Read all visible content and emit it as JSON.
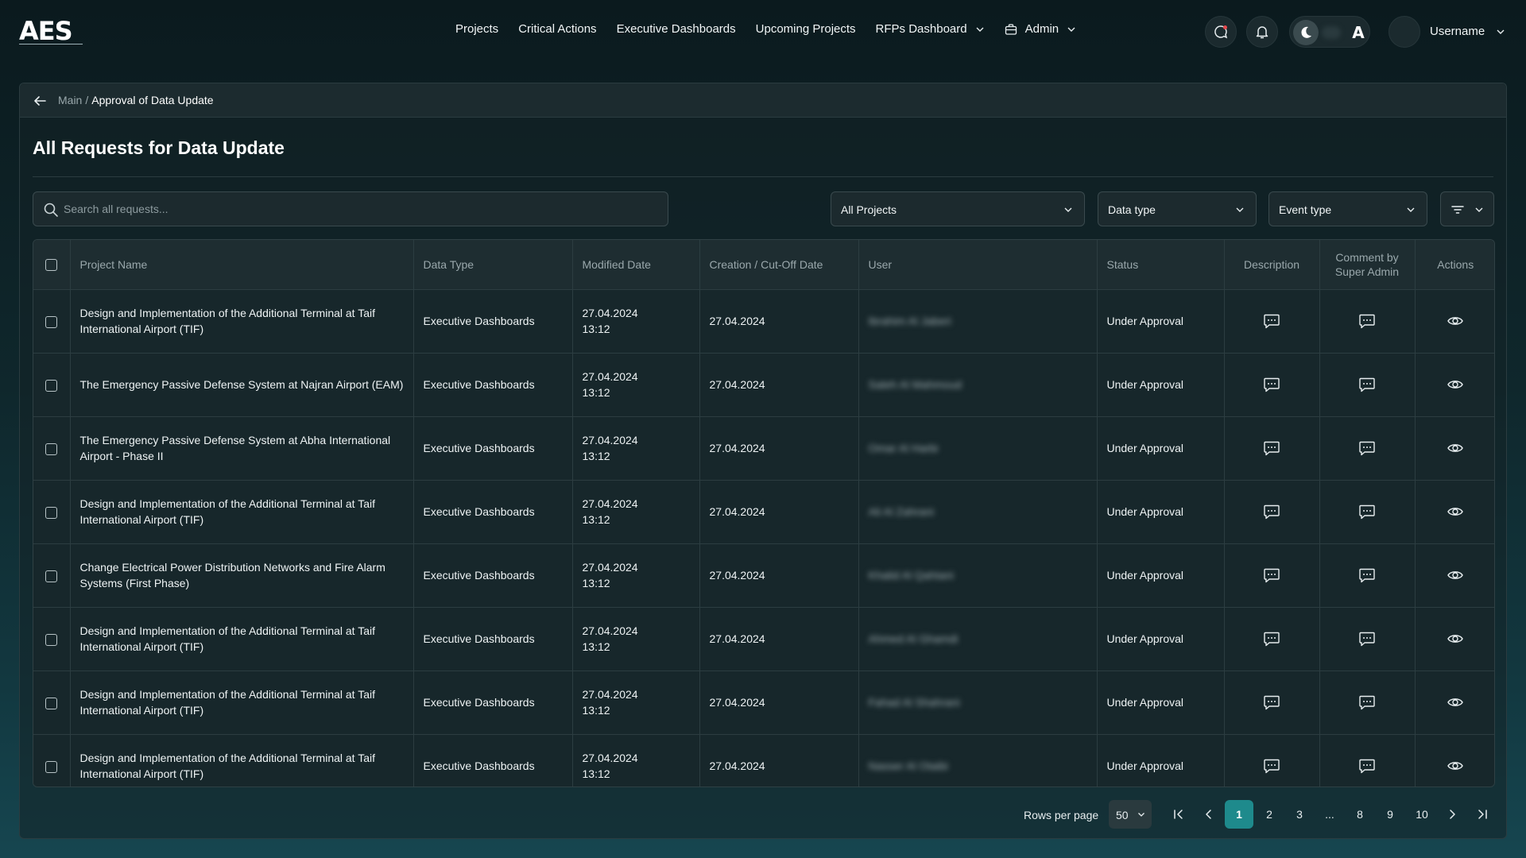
{
  "brand": {
    "logo": "AES"
  },
  "nav": {
    "items": [
      "Projects",
      "Critical Actions",
      "Executive Dashboards",
      "Upcoming Projects"
    ],
    "rfps": "RFPs Dashboard",
    "admin": "Admin"
  },
  "user": {
    "name": "Username"
  },
  "theme": {
    "letter": "A"
  },
  "breadcrumb": {
    "main": "Main",
    "sep": "/",
    "current": "Approval of Data Update"
  },
  "page": {
    "title": "All Requests for Data Update"
  },
  "filters": {
    "search_placeholder": "Search all requests...",
    "projects": "All Projects",
    "data_type": "Data type",
    "event_type": "Event type"
  },
  "table": {
    "headers": {
      "project": "Project Name",
      "data_type": "Data Type",
      "modified": "Modified Date",
      "creation": "Creation / Cut-Off Date",
      "user": "User",
      "status": "Status",
      "description": "Description",
      "comment_line1": "Comment by",
      "comment_line2": "Super Admin",
      "actions": "Actions"
    },
    "rows": [
      {
        "project": "Design and Implementation of the Additional Terminal at Taif International Airport (TIF)",
        "data_type": "Executive Dashboards",
        "mod_date": "27.04.2024",
        "mod_time": "13:12",
        "creation": "27.04.2024",
        "user": "Ibrahim Al Jaberi",
        "status": "Under Approval"
      },
      {
        "project": "The Emergency Passive Defense System at Najran Airport (EAM)",
        "data_type": "Executive Dashboards",
        "mod_date": "27.04.2024",
        "mod_time": "13:12",
        "creation": "27.04.2024",
        "user": "Saleh Al Mahmoud",
        "status": "Under Approval"
      },
      {
        "project": "The Emergency Passive Defense System at Abha International Airport - Phase II",
        "data_type": "Executive Dashboards",
        "mod_date": "27.04.2024",
        "mod_time": "13:12",
        "creation": "27.04.2024",
        "user": "Omar Al Harbi",
        "status": "Under Approval"
      },
      {
        "project": "Design and Implementation of the Additional Terminal at Taif International Airport (TIF)",
        "data_type": "Executive Dashboards",
        "mod_date": "27.04.2024",
        "mod_time": "13:12",
        "creation": "27.04.2024",
        "user": "Ali Al Zahrani",
        "status": "Under Approval"
      },
      {
        "project": "Change Electrical Power Distribution Networks and Fire Alarm Systems (First Phase)",
        "data_type": "Executive Dashboards",
        "mod_date": "27.04.2024",
        "mod_time": "13:12",
        "creation": "27.04.2024",
        "user": "Khalid Al Qahtani",
        "status": "Under Approval"
      },
      {
        "project": "Design and Implementation of the Additional Terminal at Taif International Airport (TIF)",
        "data_type": "Executive Dashboards",
        "mod_date": "27.04.2024",
        "mod_time": "13:12",
        "creation": "27.04.2024",
        "user": "Ahmed Al Ghamdi",
        "status": "Under Approval"
      },
      {
        "project": "Design and Implementation of the Additional Terminal at Taif International Airport (TIF)",
        "data_type": "Executive Dashboards",
        "mod_date": "27.04.2024",
        "mod_time": "13:12",
        "creation": "27.04.2024",
        "user": "Fahad Al Shahrani",
        "status": "Under Approval"
      },
      {
        "project": "Design and Implementation of the Additional Terminal at Taif International Airport (TIF)",
        "data_type": "Executive Dashboards",
        "mod_date": "27.04.2024",
        "mod_time": "13:12",
        "creation": "27.04.2024",
        "user": "Nasser Al Otaibi",
        "status": "Under Approval"
      }
    ]
  },
  "pagination": {
    "rows_label": "Rows per page",
    "rows_value": "50",
    "pages": [
      "1",
      "2",
      "3",
      "...",
      "8",
      "9",
      "10"
    ],
    "active_page": "1"
  },
  "colors": {
    "accent": "#1e8a8c",
    "background": "#0f272c"
  },
  "icons": [
    "chat-alert-icon",
    "bell-icon",
    "moon-icon",
    "back-arrow-icon",
    "search-icon",
    "chevron-down-icon",
    "filter-icon",
    "comment-icon",
    "eye-icon",
    "first-page-icon",
    "prev-page-icon",
    "next-page-icon",
    "last-page-icon",
    "briefcase-icon"
  ]
}
